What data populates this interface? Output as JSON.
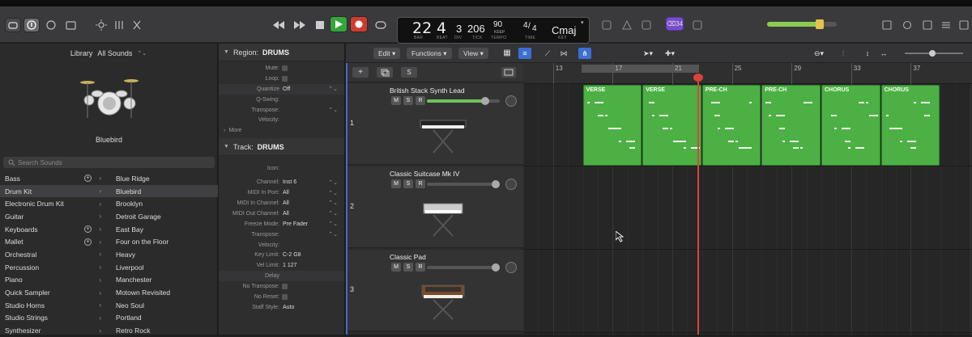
{
  "toolbar": {
    "lcd": {
      "bar": "22",
      "beat": "4",
      "div": "3",
      "tick": "206",
      "bar_lbl": "BAR",
      "beat_lbl": "BEAT",
      "div_lbl": "DIV",
      "tick_lbl": "TICK",
      "tempo": "90",
      "tempo_sub": "KEEP",
      "tempo_lbl": "TEMPO",
      "sig_top": "4",
      "sig_bottom": "4",
      "time_lbl": "TIME",
      "key": "Cmaj",
      "key_lbl": "KEY"
    },
    "count_in": "⌫34",
    "colors": {
      "play": "#35a63a",
      "record": "#d03a31",
      "accent": "#7a4bd1"
    }
  },
  "library": {
    "title": "Library",
    "filter": "All Sounds",
    "patch_name": "Bluebird",
    "search_placeholder": "Search Sounds",
    "categories": [
      "Bass",
      "Drum Kit",
      "Electronic Drum Kit",
      "Guitar",
      "Keyboards",
      "Mallet",
      "Orchestral",
      "Percussion",
      "Piano",
      "Quick Sampler",
      "Studio Horns",
      "Studio Strings",
      "Synthesizer"
    ],
    "patches": [
      "Blue Ridge",
      "Bluebird",
      "Brooklyn",
      "Detroit Garage",
      "East Bay",
      "Four on the Floor",
      "Heavy",
      "Liverpool",
      "Manchester",
      "Motown Revisited",
      "Neo Soul",
      "Portland",
      "Retro Rock"
    ]
  },
  "inspector": {
    "region_header": "Region:",
    "region_name": "DRUMS",
    "region_rows": [
      {
        "label": "Mute:",
        "value": ""
      },
      {
        "label": "Loop:",
        "value": ""
      },
      {
        "label": "Quantize",
        "value": "Off"
      },
      {
        "label": "Q-Swing:",
        "value": ""
      },
      {
        "label": "Transpose:",
        "value": ""
      },
      {
        "label": "Velocity:",
        "value": ""
      }
    ],
    "more": "More",
    "track_header": "Track:",
    "track_name": "DRUMS",
    "track_rows": [
      {
        "label": "Icon:",
        "value": ""
      },
      {
        "label": "Channel:",
        "value": "Inst 6"
      },
      {
        "label": "MIDI In Port:",
        "value": "All"
      },
      {
        "label": "MIDI In Channel:",
        "value": "All"
      },
      {
        "label": "MIDI Out Channel:",
        "value": "All"
      },
      {
        "label": "Freeze Mode:",
        "value": "Pre Fader"
      },
      {
        "label": "Transpose:",
        "value": ""
      },
      {
        "label": "Velocity:",
        "value": ""
      },
      {
        "label": "Key Limit:",
        "value": "C-2  G8"
      },
      {
        "label": "Vel Limit:",
        "value": "1  127"
      },
      {
        "label": "Delay",
        "value": ""
      },
      {
        "label": "No Transpose:",
        "value": ""
      },
      {
        "label": "No Reset:",
        "value": ""
      },
      {
        "label": "Staff Style:",
        "value": "Auto"
      }
    ]
  },
  "tracks_toolbar": {
    "edit": "Edit",
    "functions": "Functions",
    "view": "View",
    "s_button": "S"
  },
  "tracks": [
    {
      "num": "1",
      "name": "British Stack Synth Lead",
      "m": "M",
      "s": "S",
      "r": "R",
      "volume": 0.8
    },
    {
      "num": "2",
      "name": "Classic Suitcase Mk IV",
      "m": "M",
      "s": "S",
      "r": "R",
      "volume": 0.0
    },
    {
      "num": "3",
      "name": "Classic Pad",
      "m": "M",
      "s": "S",
      "r": "R",
      "volume": 0.0
    }
  ],
  "ruler": [
    "13",
    "17",
    "21",
    "25",
    "29",
    "33",
    "37"
  ],
  "regions": [
    {
      "label": "VERSE"
    },
    {
      "label": "VERSE"
    },
    {
      "label": "PRE-CH"
    },
    {
      "label": "PRE-CH"
    },
    {
      "label": "CHORUS"
    },
    {
      "label": "CHORUS"
    }
  ]
}
